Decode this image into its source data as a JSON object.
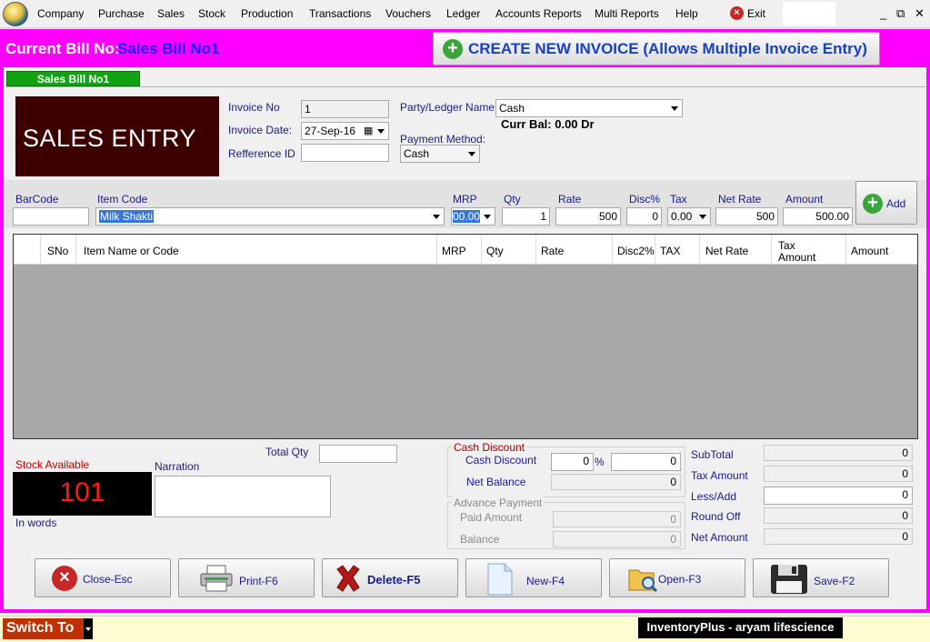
{
  "menu": {
    "items": [
      "Company",
      "Purchase",
      "Sales",
      "Stock",
      "Production",
      "Transactions",
      "Vouchers",
      "Ledger",
      "Accounts Reports",
      "Multi Reports",
      "Help"
    ],
    "exit_label": "Exit",
    "minimize": "_",
    "restore": "⧉",
    "close": "✕"
  },
  "header": {
    "current_bill_label": "Current Bill No:",
    "current_bill_value": "Sales Bill No1",
    "create_button_label": "CREATE NEW INVOICE (Allows Multiple Invoice Entry)",
    "tab_label": "Sales Bill No1"
  },
  "banner": {
    "title": "SALES ENTRY"
  },
  "invoice": {
    "no_label": "Invoice No",
    "no_value": "1",
    "date_label": "Invoice Date:",
    "date_value": "27-Sep-16",
    "ref_label": "Refference ID",
    "ref_value": "",
    "party_label": "Party/Ledger Name:",
    "party_value": "Cash",
    "curr_bal": "Curr Bal: 0.00 Dr",
    "payment_label": "Payment Method:",
    "payment_value": "Cash"
  },
  "item_entry": {
    "labels": {
      "barcode": "BarCode",
      "item_code": "Item Code",
      "mrp": "MRP",
      "qty": "Qty",
      "rate": "Rate",
      "disc": "Disc%",
      "tax": "Tax",
      "net_rate": "Net Rate",
      "amount": "Amount"
    },
    "values": {
      "barcode": "",
      "item_code": "Milk Shakti",
      "mrp": "00.00",
      "qty": "1",
      "rate": "500",
      "disc": "0",
      "tax": "0.00",
      "net_rate": "500",
      "amount": "500.00"
    },
    "add_label": "Add"
  },
  "grid": {
    "columns": [
      "SNo",
      "Item Name or Code",
      "MRP",
      "Qty",
      "Rate",
      "Disc2%",
      "TAX",
      "Net Rate",
      "Tax",
      "Amount",
      "Amount"
    ]
  },
  "bottom": {
    "total_qty_label": "Total Qty",
    "total_qty_value": "",
    "stock_label": "Stock Available",
    "stock_value": "101",
    "in_words_label": "In words",
    "narration_label": "Narration",
    "cash_discount_group": "Cash Discount",
    "cash_discount_label": "Cash Discount",
    "cash_discount_pct": "0",
    "pct_sign": "%",
    "cash_discount_amt": "0",
    "net_balance_label": "Net Balance",
    "net_balance_value": "0",
    "advance_group": "Advance Payment",
    "paid_amount_label": "Paid Amount",
    "paid_amount_value": "0",
    "balance_label": "Balance",
    "balance_value": "0",
    "subtotal_label": "SubTotal",
    "subtotal_value": "0",
    "tax_amount_label": "Tax Amount",
    "tax_amount_value": "0",
    "lessadd_label": "Less/Add",
    "lessadd_value": "0",
    "roundoff_label": "Round Off",
    "roundoff_value": "0",
    "net_amount_label": "Net Amount",
    "net_amount_value": "0"
  },
  "actions": {
    "close": "Close-Esc",
    "print": "Print-F6",
    "delete": "Delete-F5",
    "new": "New-F4",
    "open": "Open-F3",
    "save": "Save-F2"
  },
  "statusbar": {
    "switch_to": "Switch To",
    "brand": "InventoryPlus - aryam lifescience"
  },
  "colors": {
    "frame": "#ff00ff",
    "banner": "#3d0000",
    "tab": "#12a312",
    "accent_blue": "#1a3fbf"
  }
}
